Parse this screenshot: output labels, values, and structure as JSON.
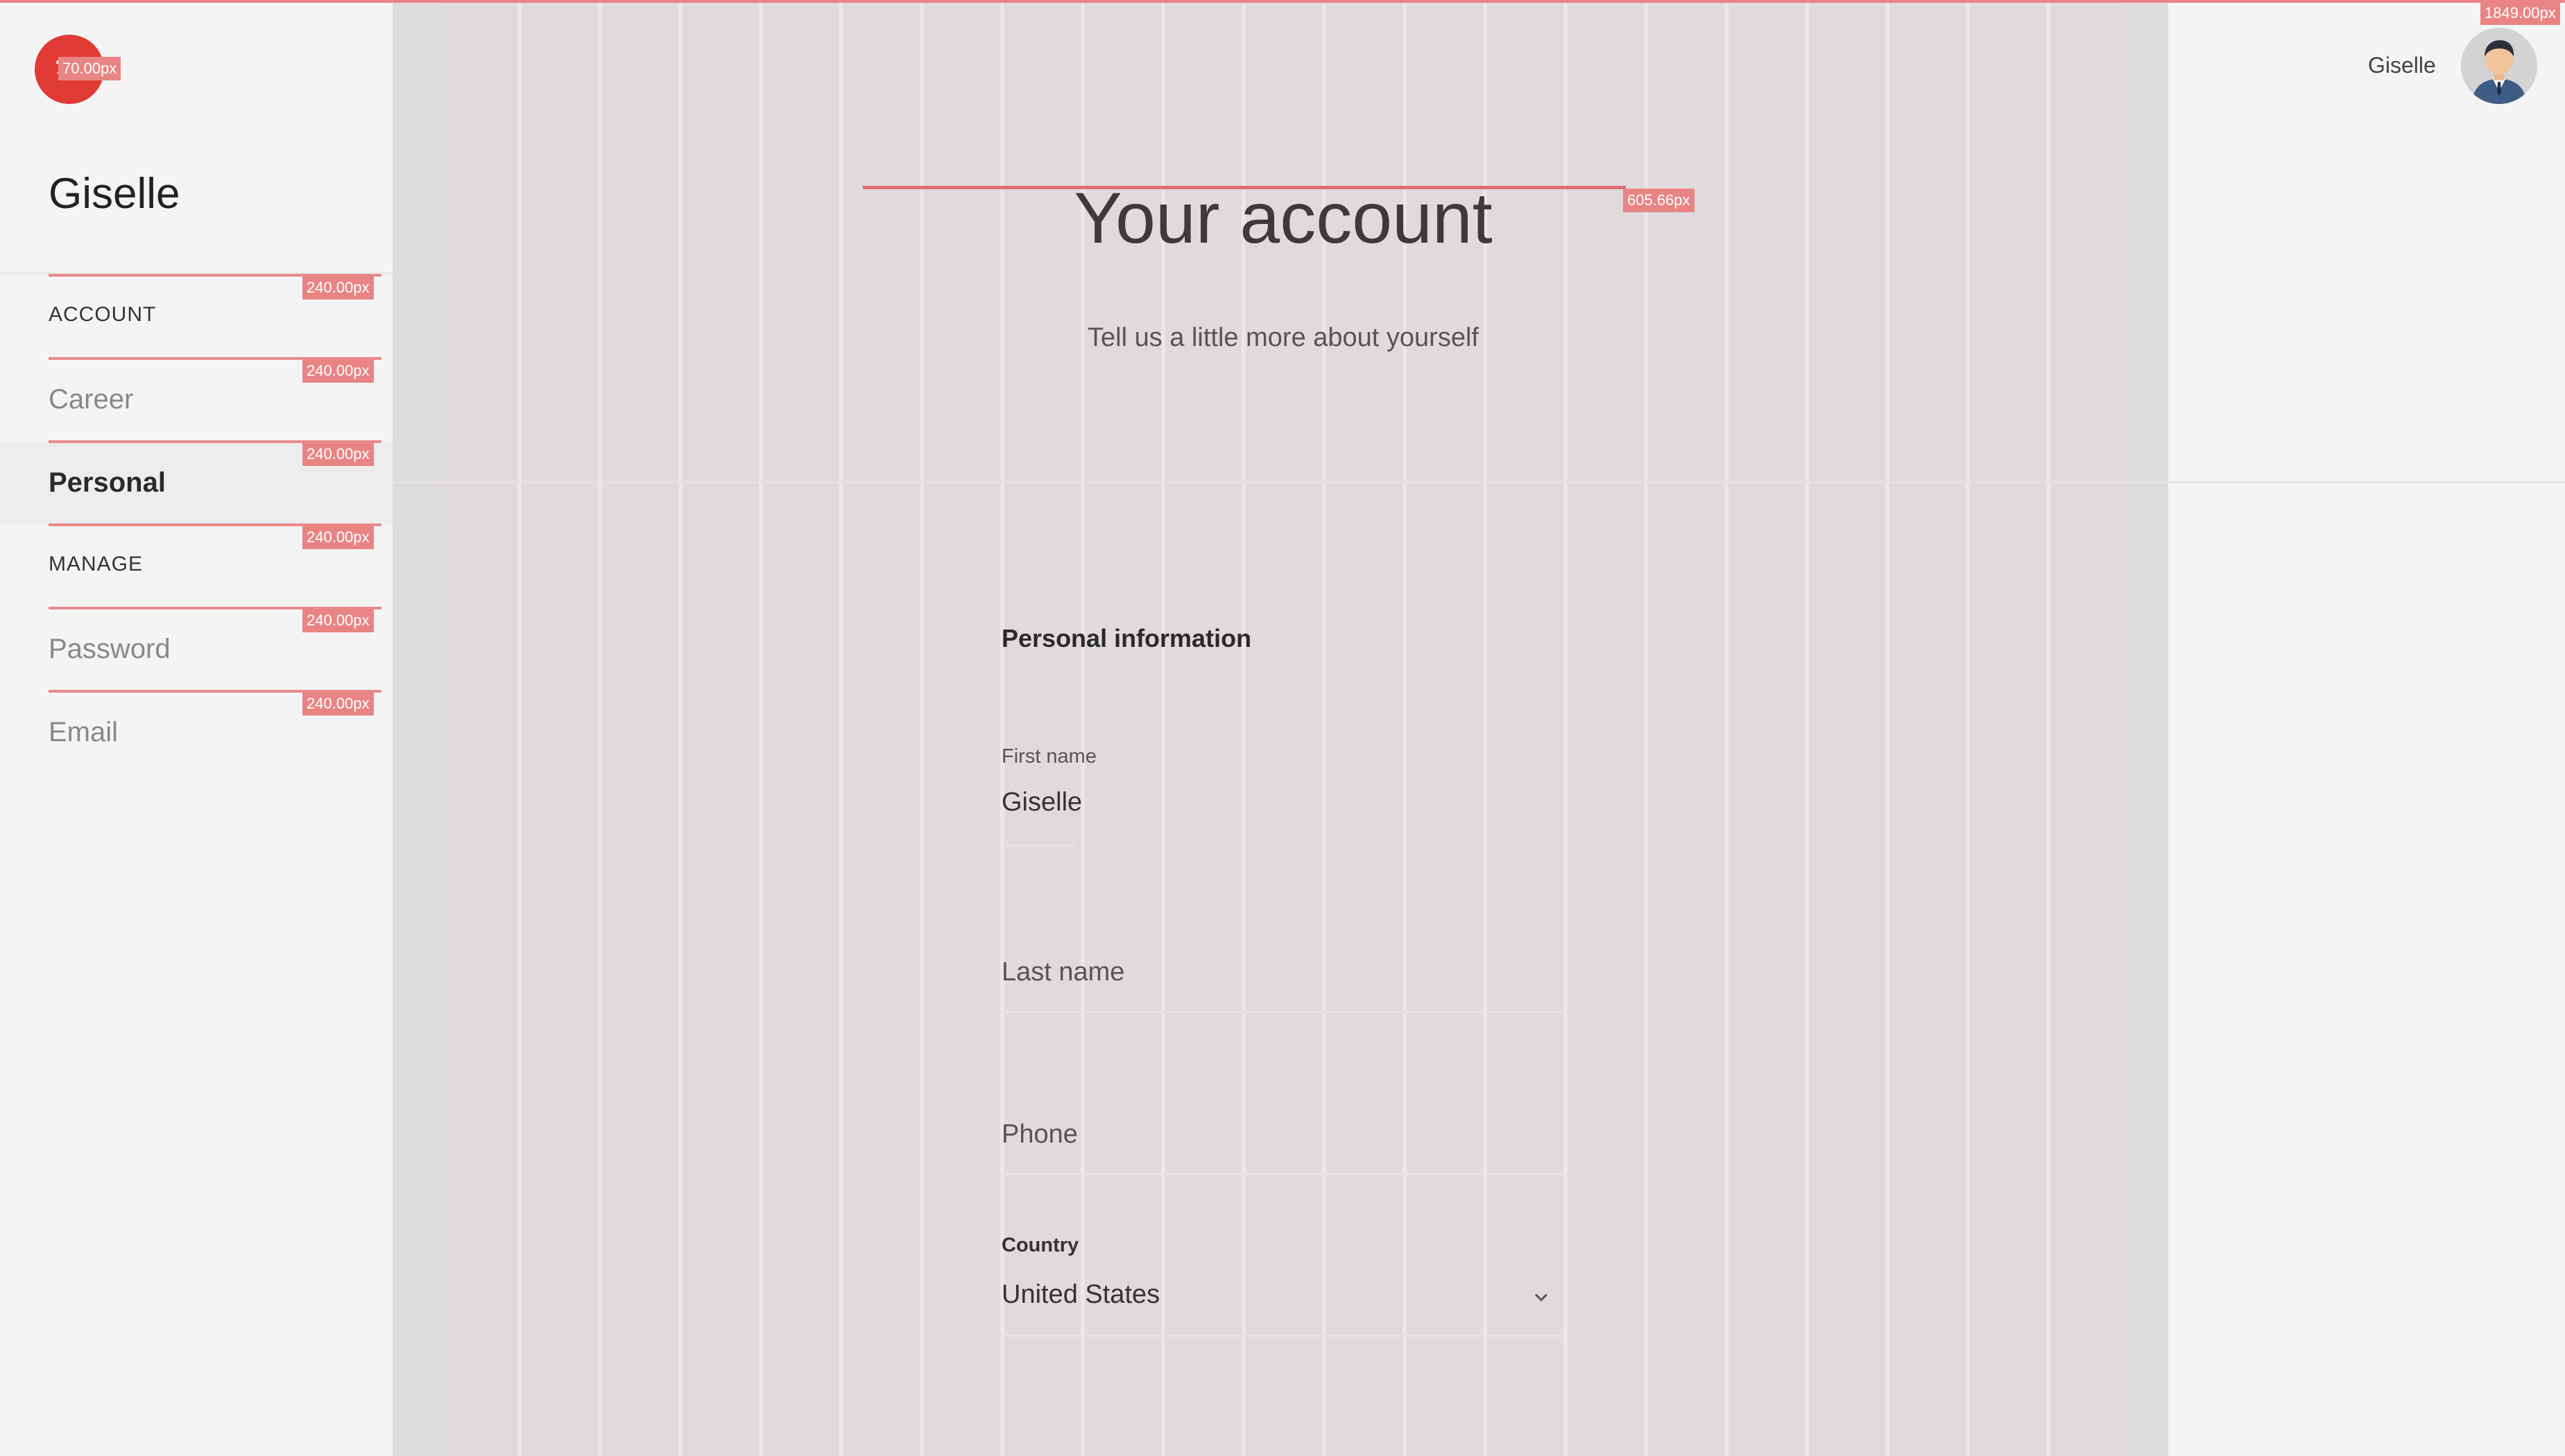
{
  "sidebar": {
    "name": "Giselle",
    "logo_glyph": "ℬ",
    "logo_tag": "70.00px",
    "items": [
      {
        "label": "ACCOUNT",
        "kind": "section"
      },
      {
        "label": "Career",
        "kind": "link"
      },
      {
        "label": "Personal",
        "kind": "active"
      },
      {
        "label": "MANAGE",
        "kind": "section"
      },
      {
        "label": "Password",
        "kind": "link"
      },
      {
        "label": "Email",
        "kind": "link"
      }
    ],
    "guide_tags": [
      "240.00px",
      "240.00px",
      "240.00px",
      "240.00px",
      "240.00px",
      "240.00px"
    ]
  },
  "header": {
    "user_name": "Giselle",
    "width_tag": "1849.00px",
    "avatar": "user-avatar-icon"
  },
  "hero": {
    "title": "Your account",
    "subtitle": "Tell us a little more about yourself",
    "measure_tag": "605.66px"
  },
  "form": {
    "section_title": "Personal information",
    "first_name": {
      "label": "First name",
      "value": "Giselle"
    },
    "last_name": {
      "placeholder": "Last name"
    },
    "phone": {
      "placeholder": "Phone"
    },
    "country": {
      "label": "Country",
      "value": "United States"
    }
  },
  "colors": {
    "accent": "#e03a34",
    "guide": "#e98484",
    "overlay": "#e0dadd"
  }
}
